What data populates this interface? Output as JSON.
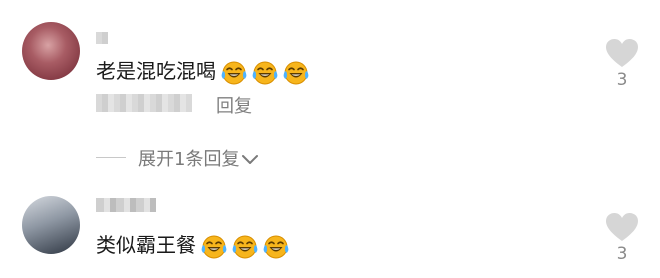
{
  "comments": [
    {
      "text": "老是混吃混喝",
      "emoji_icon": "laughing-crying-emoji-icon",
      "emoji_count": 3,
      "reply_label": "回复",
      "like_count": "3",
      "expand_replies_label": "展开1条回复"
    },
    {
      "text": "类似霸王餐",
      "emoji_icon": "laughing-crying-emoji-icon",
      "emoji_count": 3,
      "like_count": "3"
    }
  ],
  "colors": {
    "text": "#1a1a1a",
    "secondary": "#808080",
    "heart": "#d6d6d6",
    "emoji_face": "#f7b51c"
  }
}
